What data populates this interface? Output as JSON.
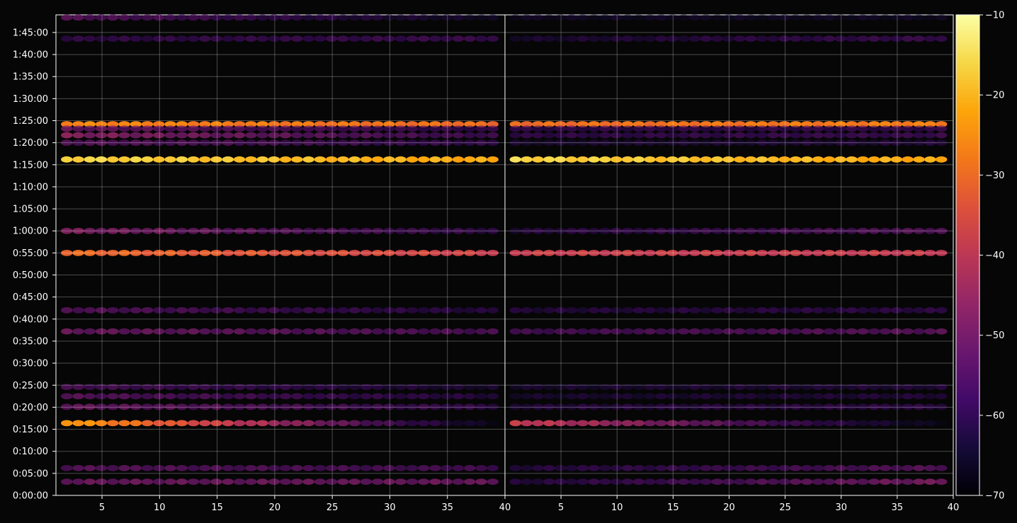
{
  "chart_data": {
    "type": "heatmap",
    "title": "",
    "xlabel": "",
    "ylabel": "",
    "grid": true,
    "colormap": "inferno",
    "background": "#060606",
    "panels": [
      {
        "name": "",
        "xlim": [
          1,
          40
        ],
        "x_ticks": [
          5,
          10,
          15,
          20,
          25,
          30,
          35,
          40
        ],
        "x_tick_labels": [
          "5",
          "10",
          "15",
          "20",
          "25",
          "30",
          "35",
          "40"
        ]
      },
      {
        "name": "",
        "xlim": [
          0,
          40
        ],
        "x_ticks": [
          5,
          10,
          15,
          20,
          25,
          30,
          35,
          40
        ],
        "x_tick_labels": [
          "5",
          "10",
          "15",
          "20",
          "25",
          "30",
          "35",
          "40"
        ]
      }
    ],
    "y_axis": {
      "unit": "seconds",
      "ylim": [
        0,
        6540
      ],
      "ticks": [
        0,
        300,
        600,
        900,
        1200,
        1500,
        1800,
        2100,
        2400,
        2700,
        3000,
        3300,
        3600,
        3900,
        4200,
        4500,
        4800,
        5100,
        5400,
        5700,
        6000,
        6300
      ],
      "tick_labels": [
        "0:00:00",
        "0:05:00",
        "0:10:00",
        "0:15:00",
        "0:20:00",
        "0:25:00",
        "0:30:00",
        "0:35:00",
        "0:40:00",
        "0:45:00",
        "0:50:00",
        "0:55:00",
        "1:00:00",
        "1:05:00",
        "1:10:00",
        "1:15:00",
        "1:20:00",
        "1:25:00",
        "1:30:00",
        "1:35:00",
        "1:40:00",
        "1:45:00"
      ]
    },
    "colorbar": {
      "range": [
        -70,
        -10
      ],
      "ticks": [
        -10,
        -20,
        -30,
        -40,
        -50,
        -60,
        -70
      ],
      "tick_labels": [
        "−10",
        "−20",
        "−30",
        "−40",
        "−50",
        "−60",
        "−70"
      ]
    },
    "rows": [
      {
        "y": 4572,
        "level_left": [
          -16,
          -22
        ],
        "level_right": [
          -16,
          -22
        ]
      },
      {
        "y": 5052,
        "level_left": [
          -26,
          -30
        ],
        "level_right": [
          -30,
          -27
        ]
      },
      {
        "y": 3300,
        "level_left": [
          -30,
          -38
        ],
        "level_right": [
          -38,
          -39
        ]
      },
      {
        "y": 3600,
        "level_left": [
          -47,
          -58
        ],
        "level_right": [
          -60,
          -52
        ]
      },
      {
        "y": 4902,
        "level_left": [
          -46,
          -56
        ],
        "level_right": [
          -58,
          -56
        ]
      },
      {
        "y": 4992,
        "level_left": [
          -50,
          -58
        ],
        "level_right": [
          -58,
          -57
        ]
      },
      {
        "y": 4800,
        "level_left": [
          -52,
          -58
        ],
        "level_right": [
          -62,
          -60
        ]
      },
      {
        "y": 984,
        "level_left": [
          -22,
          -66
        ],
        "level_right": [
          -38,
          -66
        ]
      },
      {
        "y": 1206,
        "level_left": [
          -50,
          -58
        ],
        "level_right": [
          -60,
          -58
        ]
      },
      {
        "y": 1350,
        "level_left": [
          -52,
          -60
        ],
        "level_right": [
          -62,
          -60
        ]
      },
      {
        "y": 1476,
        "level_left": [
          -54,
          -62
        ],
        "level_right": [
          -62,
          -60
        ]
      },
      {
        "y": 2232,
        "level_left": [
          -50,
          -54
        ],
        "level_right": [
          -55,
          -52
        ]
      },
      {
        "y": 2520,
        "level_left": [
          -52,
          -60
        ],
        "level_right": [
          -60,
          -58
        ]
      },
      {
        "y": 186,
        "level_left": [
          -50,
          -50
        ],
        "level_right": [
          -60,
          -48
        ]
      },
      {
        "y": 372,
        "level_left": [
          -52,
          -55
        ],
        "level_right": [
          -60,
          -52
        ]
      },
      {
        "y": 6216,
        "level_left": [
          -58,
          -56
        ],
        "level_right": [
          -62,
          -56
        ]
      },
      {
        "y": 6504,
        "level_left": [
          -52,
          -64
        ],
        "level_right": [
          -64,
          -64
        ]
      }
    ]
  }
}
